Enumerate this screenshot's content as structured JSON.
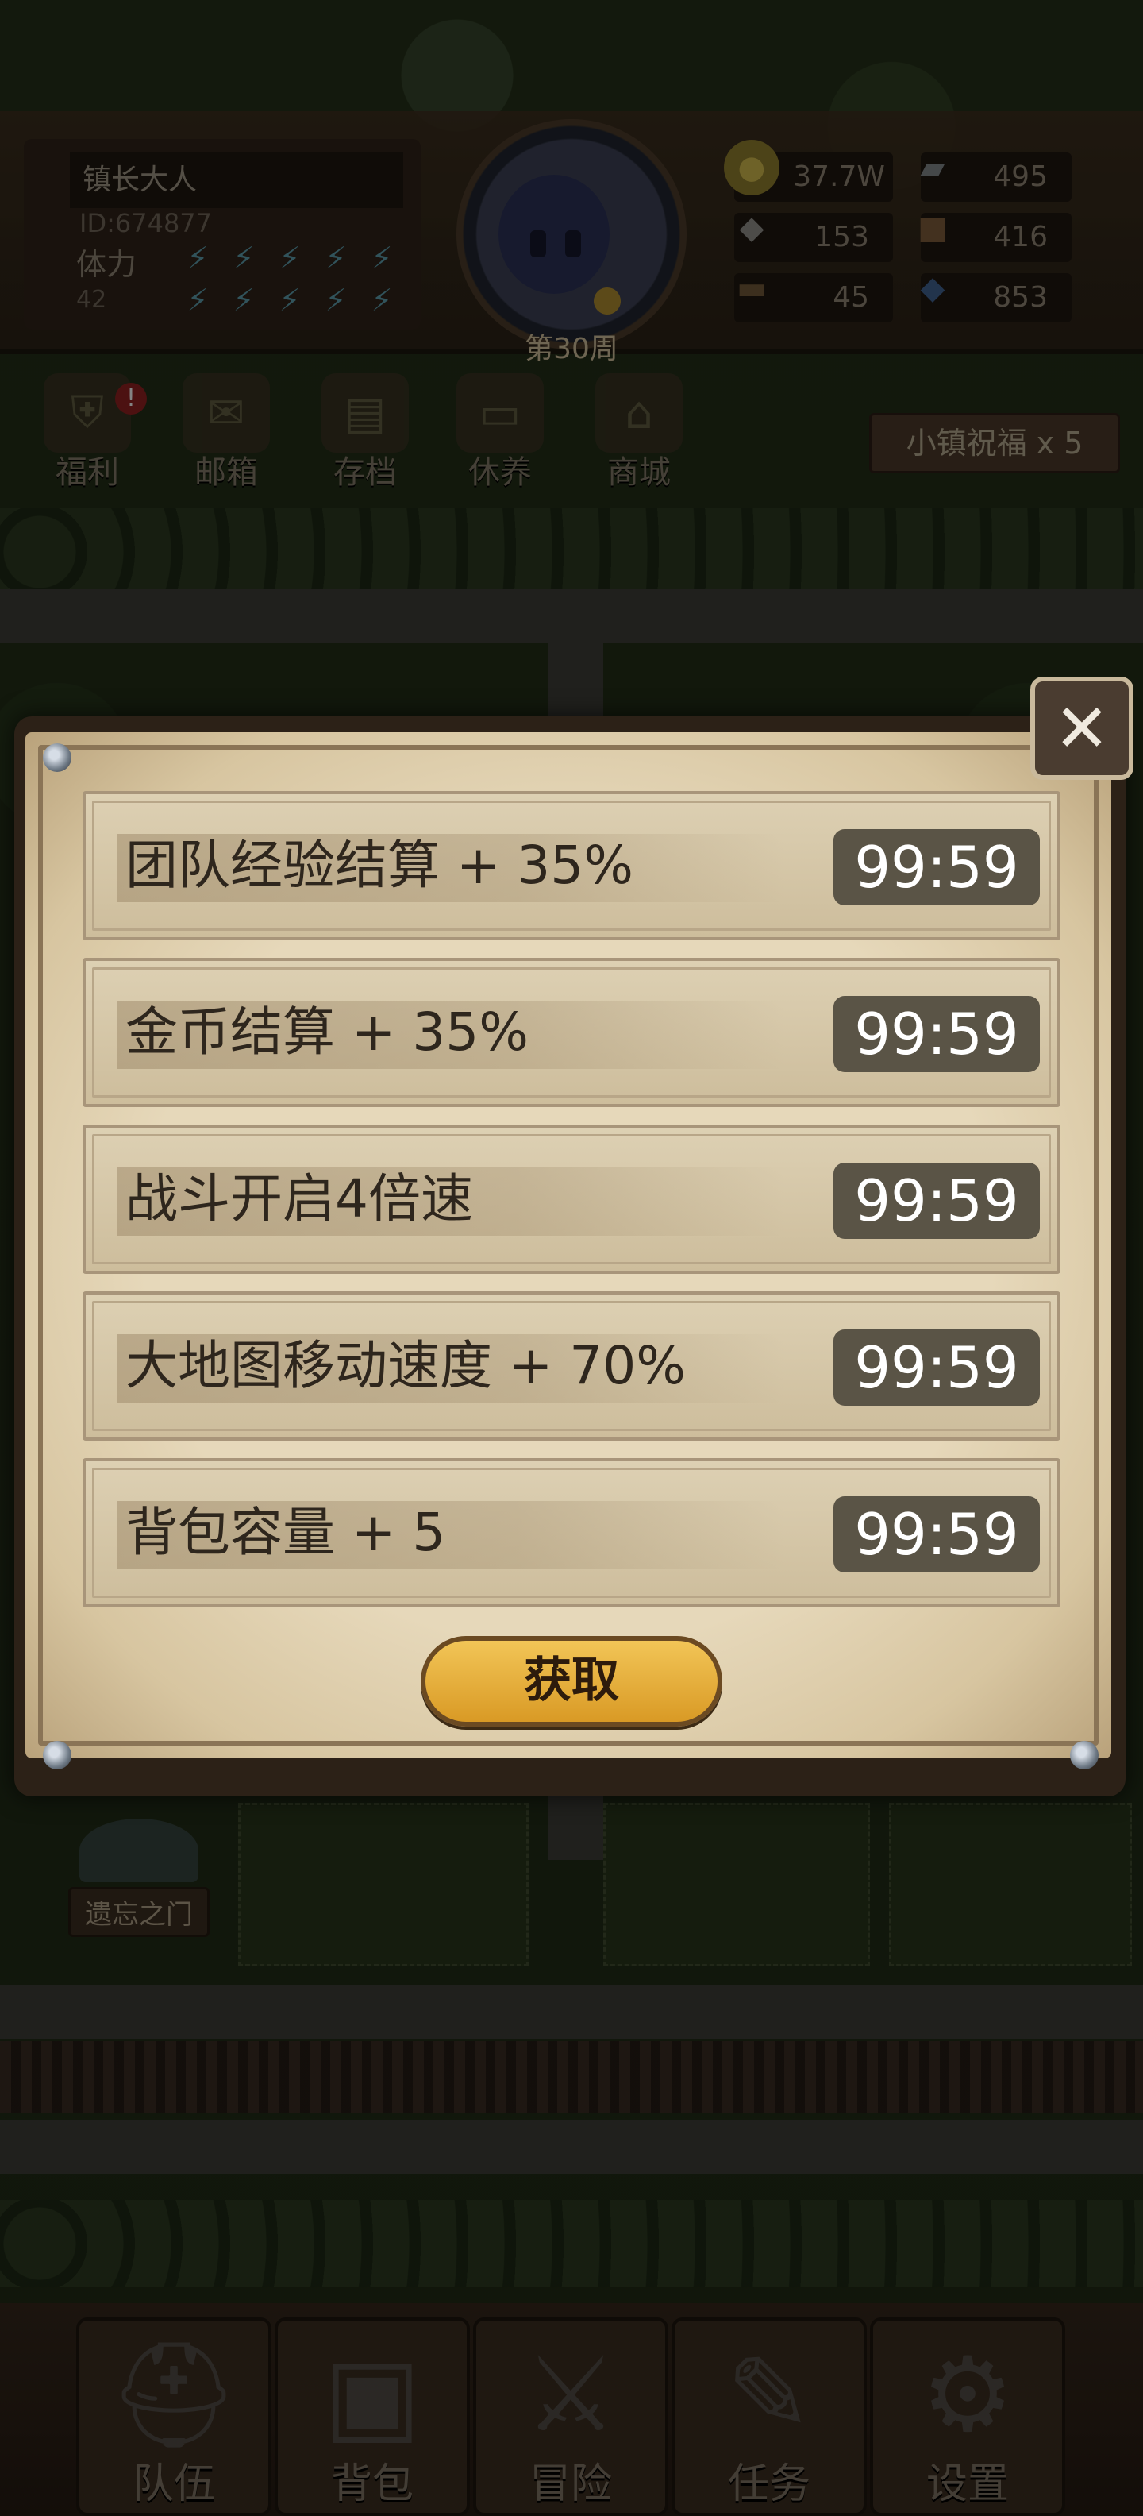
{
  "hud": {
    "player_name": "镇长大人",
    "player_id": "ID:674877",
    "stamina_label": "体力",
    "stamina_value": "42",
    "week": "第30周",
    "resources": {
      "gold": "37.7W",
      "iron": "495",
      "stone": "153",
      "leather": "416",
      "wood": "45",
      "crystal": "853"
    }
  },
  "quick_menu": {
    "welfare": "福利",
    "mailbox": "邮箱",
    "save": "存档",
    "rest": "休养",
    "shop": "商城",
    "welfare_badge": "!"
  },
  "town_blessing": "小镇祝福 x 5",
  "forgotten_gate": "遗忘之门",
  "modal": {
    "close_icon": "crossed-swords-close-icon",
    "buffs": [
      {
        "label": "团队经验结算 + 35%",
        "timer": "99:59"
      },
      {
        "label": "金币结算 + 35%",
        "timer": "99:59"
      },
      {
        "label": "战斗开启4倍速",
        "timer": "99:59"
      },
      {
        "label": "大地图移动速度 + 70%",
        "timer": "99:59"
      },
      {
        "label": "背包容量 + 5",
        "timer": "99:59"
      }
    ],
    "get_button": "获取"
  },
  "bottom_nav": {
    "team": "队伍",
    "bag": "背包",
    "adventure": "冒险",
    "tasks": "任务",
    "settings": "设置"
  },
  "colors": {
    "paper": "#e6d8ba",
    "timer_bg": "#5a5446",
    "button_gold": "#f2c557",
    "frame_dark": "#2c2117"
  }
}
